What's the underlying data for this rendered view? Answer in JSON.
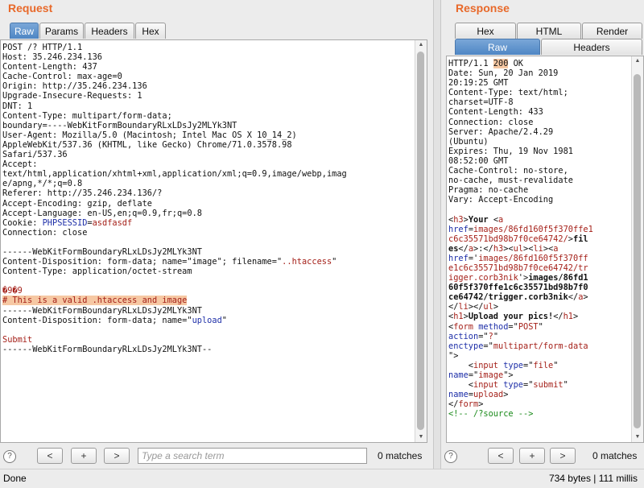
{
  "request": {
    "title": "Request",
    "tabs": [
      "Raw",
      "Params",
      "Headers",
      "Hex"
    ],
    "active_tab": "Raw",
    "lines": [
      [
        [
          "POST /? HTTP/1.1",
          ""
        ]
      ],
      [
        [
          "Host: 35.246.234.136",
          ""
        ]
      ],
      [
        [
          "Content-Length: 437",
          ""
        ]
      ],
      [
        [
          "Cache-Control: max-age=0",
          ""
        ]
      ],
      [
        [
          "Origin: http://35.246.234.136",
          ""
        ]
      ],
      [
        [
          "Upgrade-Insecure-Requests: 1",
          ""
        ]
      ],
      [
        [
          "DNT: 1",
          ""
        ]
      ],
      [
        [
          "Content-Type: multipart/form-data;",
          ""
        ]
      ],
      [
        [
          "boundary=----WebKitFormBoundaryRLxLDsJy2MLYk3NT",
          ""
        ]
      ],
      [
        [
          "User-Agent: Mozilla/5.0 (Macintosh; Intel Mac OS X 10_14_2)",
          ""
        ]
      ],
      [
        [
          "AppleWebKit/537.36 (KHTML, like Gecko) Chrome/71.0.3578.98",
          ""
        ]
      ],
      [
        [
          "Safari/537.36",
          ""
        ]
      ],
      [
        [
          "Accept:",
          ""
        ]
      ],
      [
        [
          "text/html,application/xhtml+xml,application/xml;q=0.9,image/webp,imag",
          ""
        ]
      ],
      [
        [
          "e/apng,*/*;q=0.8",
          ""
        ]
      ],
      [
        [
          "Referer: http://35.246.234.136/?",
          ""
        ]
      ],
      [
        [
          "Accept-Encoding: gzip, deflate",
          ""
        ]
      ],
      [
        [
          "Accept-Language: en-US,en;q=0.9,fr;q=0.8",
          ""
        ]
      ],
      [
        [
          "Cookie: ",
          ""
        ],
        [
          "PHPSESSID",
          "blue"
        ],
        [
          "=",
          ""
        ],
        [
          "asdfasdf",
          "red"
        ]
      ],
      [
        [
          "Connection: close",
          ""
        ]
      ],
      [
        [
          "",
          ""
        ]
      ],
      [
        [
          "------WebKitFormBoundaryRLxLDsJy2MLYk3NT",
          ""
        ]
      ],
      [
        [
          "Content-Disposition: form-data; name=\"image\"; filename=\"",
          ""
        ],
        [
          "..htaccess",
          "red"
        ],
        [
          "\"",
          ""
        ]
      ],
      [
        [
          "Content-Type: application/octet-stream",
          ""
        ]
      ],
      [
        [
          "",
          ""
        ]
      ],
      [
        [
          "�9�9",
          "red"
        ]
      ],
      [
        [
          "# This is a valid .htaccess and image",
          "red hl"
        ]
      ],
      [
        [
          "------WebKitFormBoundaryRLxLDsJy2MLYk3NT",
          ""
        ]
      ],
      [
        [
          "Content-Disposition: form-data; name=\"",
          ""
        ],
        [
          "upload",
          "blue"
        ],
        [
          "\"",
          ""
        ]
      ],
      [
        [
          "",
          ""
        ]
      ],
      [
        [
          "Submit",
          "red"
        ]
      ],
      [
        [
          "------WebKitFormBoundaryRLxLDsJy2MLYk3NT--",
          ""
        ]
      ]
    ],
    "search_placeholder": "Type a search term",
    "matches": "0 matches"
  },
  "response": {
    "title": "Response",
    "tabs_row1": [
      "Hex",
      "HTML",
      "Render"
    ],
    "tabs_row2": [
      "Raw",
      "Headers"
    ],
    "active_tab": "Raw",
    "lines": [
      [
        [
          "HTTP/1.1 ",
          ""
        ],
        [
          "200",
          "hl"
        ],
        [
          " OK",
          ""
        ]
      ],
      [
        [
          "Date: Sun, 20 Jan 2019",
          ""
        ]
      ],
      [
        [
          "20:19:25 GMT",
          ""
        ]
      ],
      [
        [
          "Content-Type: text/html;",
          ""
        ]
      ],
      [
        [
          "charset=UTF-8",
          ""
        ]
      ],
      [
        [
          "Content-Length: 433",
          ""
        ]
      ],
      [
        [
          "Connection: close",
          ""
        ]
      ],
      [
        [
          "Server: Apache/2.4.29",
          ""
        ]
      ],
      [
        [
          "(Ubuntu)",
          ""
        ]
      ],
      [
        [
          "Expires: Thu, 19 Nov 1981",
          ""
        ]
      ],
      [
        [
          "08:52:00 GMT",
          ""
        ]
      ],
      [
        [
          "Cache-Control: no-store,",
          ""
        ]
      ],
      [
        [
          "no-cache, must-revalidate",
          ""
        ]
      ],
      [
        [
          "Pragma: no-cache",
          ""
        ]
      ],
      [
        [
          "Vary: Accept-Encoding",
          ""
        ]
      ],
      [
        [
          "",
          ""
        ]
      ],
      [
        [
          "<",
          ""
        ],
        [
          "h3",
          "red"
        ],
        [
          ">",
          ""
        ],
        [
          "Your ",
          "bold"
        ],
        [
          "<",
          ""
        ],
        [
          "a",
          "red"
        ]
      ],
      [
        [
          "href",
          "blue"
        ],
        [
          "=",
          ""
        ],
        [
          "images/86fd160f5f370ffe1",
          "red"
        ]
      ],
      [
        [
          "c6c35571bd98b7f0ce64742/",
          "red"
        ],
        [
          ">",
          ""
        ],
        [
          "fil",
          "bold"
        ]
      ],
      [
        [
          "es",
          "bold"
        ],
        [
          "</",
          ""
        ],
        [
          "a",
          "red"
        ],
        [
          ">:</",
          ""
        ],
        [
          "h3",
          "red"
        ],
        [
          "><",
          ""
        ],
        [
          "ul",
          "red"
        ],
        [
          "><",
          ""
        ],
        [
          "li",
          "red"
        ],
        [
          "><",
          ""
        ],
        [
          "a",
          "red"
        ]
      ],
      [
        [
          "href",
          "blue"
        ],
        [
          "='",
          ""
        ],
        [
          "images/86fd160f5f370ff",
          "red"
        ]
      ],
      [
        [
          "e1c6c35571bd98b7f0ce64742/tr",
          "red"
        ]
      ],
      [
        [
          "igger.corb3nik",
          "red"
        ],
        [
          "'>",
          ""
        ],
        [
          "images/86fd1",
          "bold"
        ]
      ],
      [
        [
          "60f5f370ffe1c6c35571bd98b7f0",
          "bold"
        ]
      ],
      [
        [
          "ce64742/trigger.corb3nik",
          "bold"
        ],
        [
          "</",
          ""
        ],
        [
          "a",
          "red"
        ],
        [
          ">",
          ""
        ]
      ],
      [
        [
          "</",
          ""
        ],
        [
          "li",
          "red"
        ],
        [
          "></",
          ""
        ],
        [
          "ul",
          "red"
        ],
        [
          ">",
          ""
        ]
      ],
      [
        [
          "<",
          ""
        ],
        [
          "h1",
          "red"
        ],
        [
          ">",
          ""
        ],
        [
          "Upload your pics!",
          "bold"
        ],
        [
          "</",
          ""
        ],
        [
          "h1",
          "red"
        ],
        [
          ">",
          ""
        ]
      ],
      [
        [
          "<",
          ""
        ],
        [
          "form",
          "red"
        ],
        [
          " ",
          ""
        ],
        [
          "method",
          "blue"
        ],
        [
          "=\"",
          ""
        ],
        [
          "POST",
          "red"
        ],
        [
          "\"",
          ""
        ]
      ],
      [
        [
          "action",
          "blue"
        ],
        [
          "=\"",
          ""
        ],
        [
          "?",
          "red"
        ],
        [
          "\"",
          ""
        ]
      ],
      [
        [
          "enctype",
          "blue"
        ],
        [
          "=\"",
          ""
        ],
        [
          "multipart/form-data",
          "red"
        ]
      ],
      [
        [
          "\">",
          ""
        ]
      ],
      [
        [
          "    <",
          ""
        ],
        [
          "input",
          "red"
        ],
        [
          " ",
          ""
        ],
        [
          "type",
          "blue"
        ],
        [
          "=\"",
          ""
        ],
        [
          "file",
          "red"
        ],
        [
          "\"",
          ""
        ]
      ],
      [
        [
          "name",
          "blue"
        ],
        [
          "=\"",
          ""
        ],
        [
          "image",
          "red"
        ],
        [
          "\">",
          ""
        ]
      ],
      [
        [
          "    <",
          ""
        ],
        [
          "input",
          "red"
        ],
        [
          " ",
          ""
        ],
        [
          "type",
          "blue"
        ],
        [
          "=\"",
          ""
        ],
        [
          "submit",
          "red"
        ],
        [
          "\"",
          ""
        ]
      ],
      [
        [
          "name",
          "blue"
        ],
        [
          "=",
          ""
        ],
        [
          "upload",
          "red"
        ],
        [
          ">",
          ""
        ]
      ],
      [
        [
          "</",
          ""
        ],
        [
          "form",
          "red"
        ],
        [
          ">",
          ""
        ]
      ],
      [
        [
          "<!-- /?source -->",
          "green"
        ]
      ]
    ],
    "search_placeholder": "",
    "matches": "0 matches"
  },
  "nav": {
    "prev": "<",
    "add": "+",
    "next": ">",
    "help": "?"
  },
  "status": {
    "left": "Done",
    "right": "734 bytes | 111 millis"
  }
}
